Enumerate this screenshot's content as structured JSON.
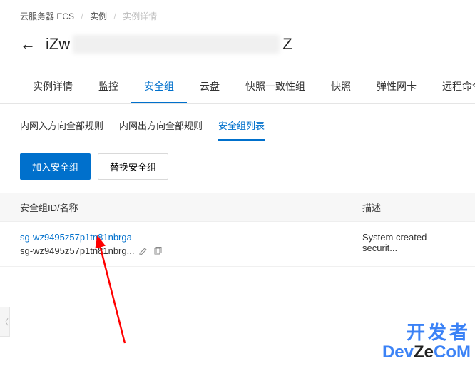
{
  "breadcrumb": {
    "item1": "云服务器 ECS",
    "item2": "实例",
    "current": "实例详情"
  },
  "title": {
    "prefix": "iZw",
    "suffix": "Z"
  },
  "main_tabs": [
    {
      "label": "实例详情"
    },
    {
      "label": "监控"
    },
    {
      "label": "安全组"
    },
    {
      "label": "云盘"
    },
    {
      "label": "快照一致性组"
    },
    {
      "label": "快照"
    },
    {
      "label": "弹性网卡"
    },
    {
      "label": "远程命令/"
    }
  ],
  "sub_tabs": [
    {
      "label": "内网入方向全部规则"
    },
    {
      "label": "内网出方向全部规则"
    },
    {
      "label": "安全组列表"
    }
  ],
  "buttons": {
    "add": "加入安全组",
    "replace": "替换安全组"
  },
  "table": {
    "headers": {
      "id": "安全组ID/名称",
      "desc": "描述"
    },
    "rows": [
      {
        "id": "sg-wz9495z57p1tn81nbrga",
        "name": "sg-wz9495z57p1tn81nbrg...",
        "desc": "System created securit..."
      }
    ]
  },
  "watermark": {
    "line1": "开发者",
    "line2_a": "Dev",
    "line2_b": "Ze",
    "line2_c": "CoM"
  }
}
